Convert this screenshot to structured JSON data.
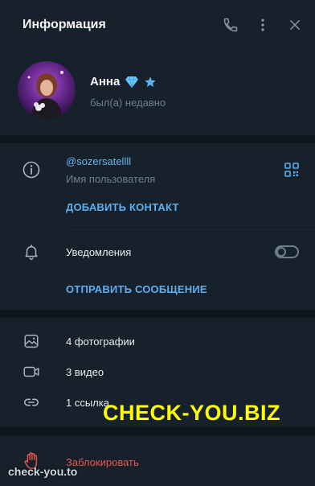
{
  "header": {
    "title": "Информация"
  },
  "profile": {
    "name": "Анна",
    "status": "был(а) недавно",
    "badges": [
      "diamond-icon",
      "star-icon"
    ]
  },
  "info": {
    "username": "@sozersatellll",
    "username_label": "Имя пользователя",
    "add_contact": "ДОБАВИТЬ КОНТАКТ",
    "notifications_label": "Уведомления",
    "notifications_enabled": false,
    "send_message": "ОТПРАВИТЬ СООБЩЕНИЕ"
  },
  "media": {
    "photos": "4 фотографии",
    "videos": "3 видео",
    "links": "1 ссылка"
  },
  "actions": {
    "block": "Заблокировать"
  },
  "watermarks": {
    "main": "CHECK-YOU.BIZ",
    "corner": "check-you.to"
  },
  "colors": {
    "background": "#17212b",
    "accent": "#5eaef2",
    "danger": "#e8554e",
    "muted": "#6d7f8f",
    "watermark": "#ffff00"
  }
}
